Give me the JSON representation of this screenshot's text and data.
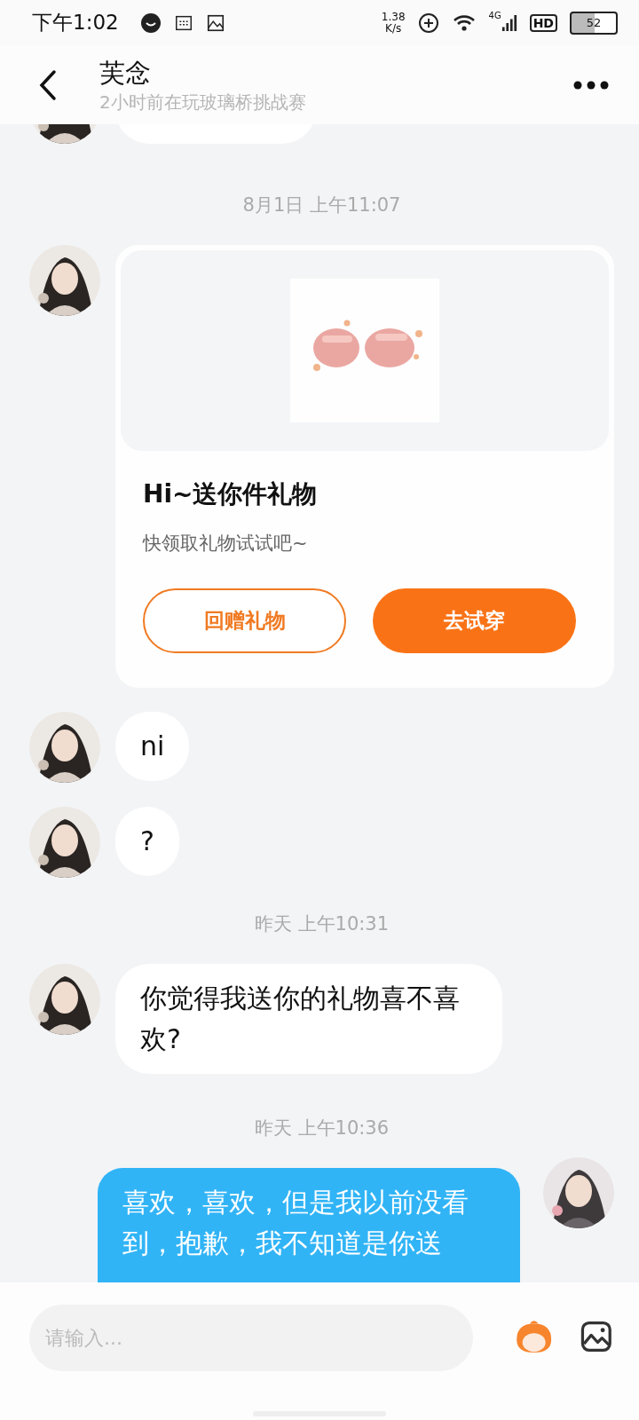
{
  "status_bar": {
    "time": "下午1:02",
    "net_speed": [
      "1.38",
      "K/s"
    ],
    "network": "4G",
    "hd": "HD",
    "battery": "52"
  },
  "header": {
    "title": "芙念",
    "subtitle": "2小时前在玩玻璃桥挑战赛"
  },
  "messages": [
    {
      "kind": "clipped",
      "outgoing": false
    },
    {
      "kind": "time",
      "text": "8月1日 上午11:07"
    },
    {
      "kind": "gift",
      "outgoing": false,
      "title": "Hi~送你件礼物",
      "subtitle": "快领取礼物试试吧~",
      "buttons": [
        {
          "label": "回赠礼物",
          "primary": false
        },
        {
          "label": "去试穿",
          "primary": true
        }
      ]
    },
    {
      "kind": "text",
      "outgoing": false,
      "text": "ni"
    },
    {
      "kind": "text",
      "outgoing": false,
      "text": "?"
    },
    {
      "kind": "time",
      "text": "昨天 上午10:31"
    },
    {
      "kind": "text",
      "outgoing": false,
      "text": "你觉得我送你的礼物喜不喜欢?"
    },
    {
      "kind": "time",
      "text": "昨天 上午10:36"
    },
    {
      "kind": "text",
      "outgoing": true,
      "text": "喜欢，喜欢，但是我以前没看到，抱歉，我不知道是你送"
    }
  ],
  "composer": {
    "placeholder": "请输入..."
  }
}
